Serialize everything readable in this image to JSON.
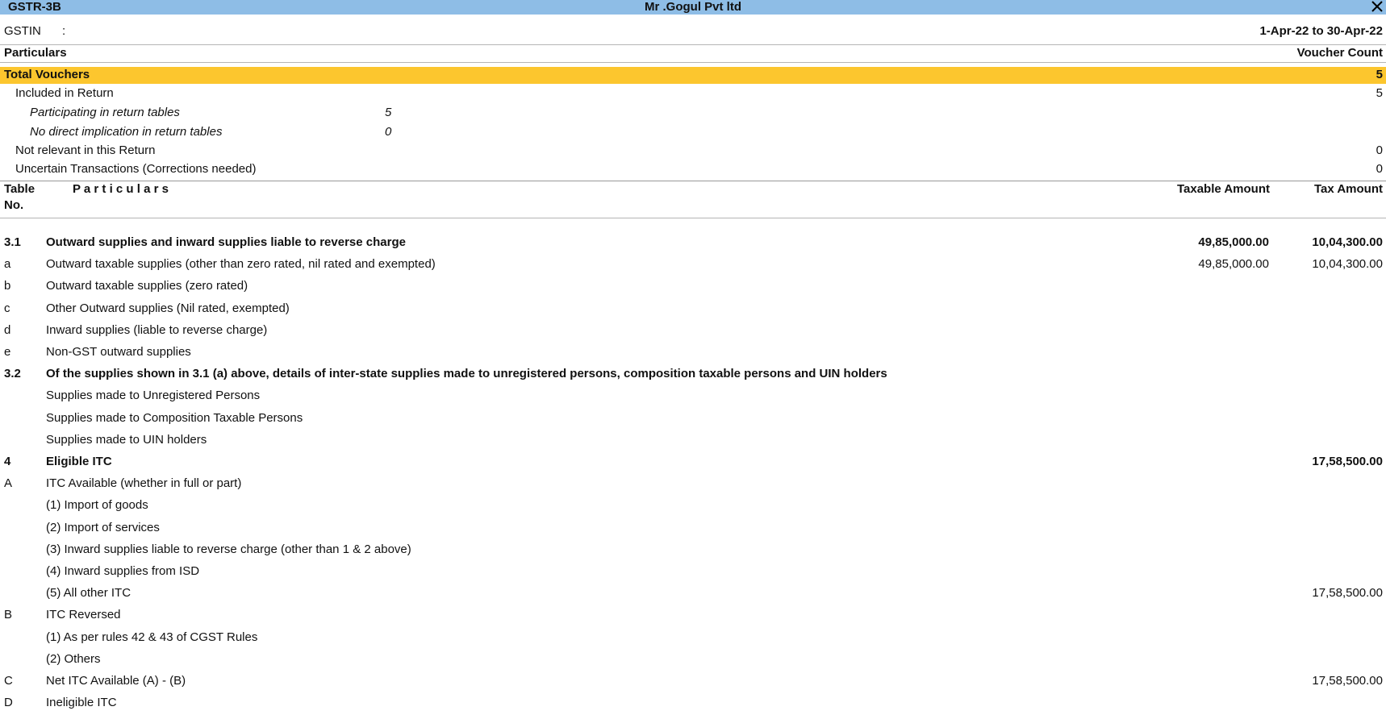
{
  "window": {
    "title": "GSTR-3B",
    "company": "Mr .Gogul Pvt ltd"
  },
  "header": {
    "gstin_label": "GSTIN",
    "gstin_colon": ":",
    "period": "1-Apr-22 to 30-Apr-22"
  },
  "summary": {
    "col_particulars": "Particulars",
    "col_count": "Voucher Count",
    "total": {
      "label": "Total Vouchers",
      "value": "5"
    },
    "included": {
      "label": "Included in Return",
      "value": "5"
    },
    "participating": {
      "label": "Participating in return tables",
      "value": "5"
    },
    "no_direct": {
      "label": "No direct implication in return tables",
      "value": "0"
    },
    "not_relevant": {
      "label": "Not relevant in this Return",
      "value": "0"
    },
    "uncertain": {
      "label": "Uncertain Transactions (Corrections needed)",
      "value": "0"
    }
  },
  "table": {
    "col_table": "Table",
    "col_no": "No.",
    "col_particulars": "P a r t i c u l a r s",
    "col_taxable": "Taxable Amount",
    "col_tax": "Tax Amount",
    "rows": [
      {
        "no": "3.1",
        "label": "Outward supplies and inward supplies liable to reverse charge",
        "taxable": "49,85,000.00",
        "tax": "10,04,300.00"
      },
      {
        "no": "a",
        "label": "Outward taxable supplies (other than zero rated, nil rated and exempted)",
        "taxable": "49,85,000.00",
        "tax": "10,04,300.00"
      },
      {
        "no": "b",
        "label": "Outward taxable supplies (zero rated)",
        "taxable": "",
        "tax": ""
      },
      {
        "no": "c",
        "label": "Other Outward supplies (Nil rated, exempted)",
        "taxable": "",
        "tax": ""
      },
      {
        "no": "d",
        "label": "Inward supplies (liable to reverse charge)",
        "taxable": "",
        "tax": ""
      },
      {
        "no": "e",
        "label": "Non-GST outward supplies",
        "taxable": "",
        "tax": ""
      },
      {
        "no": "3.2",
        "label": "Of the supplies shown in 3.1 (a) above, details of inter-state supplies made to unregistered persons, composition taxable persons and UIN holders",
        "taxable": "",
        "tax": ""
      },
      {
        "no": "",
        "label": "Supplies made to Unregistered Persons",
        "taxable": "",
        "tax": ""
      },
      {
        "no": "",
        "label": "Supplies made to Composition Taxable Persons",
        "taxable": "",
        "tax": ""
      },
      {
        "no": "",
        "label": "Supplies made to UIN holders",
        "taxable": "",
        "tax": ""
      },
      {
        "no": "4",
        "label": "Eligible ITC",
        "taxable": "",
        "tax": "17,58,500.00"
      },
      {
        "no": "A",
        "label": "ITC Available (whether in full or part)",
        "taxable": "",
        "tax": ""
      },
      {
        "no": "",
        "label": "(1) Import of goods",
        "taxable": "",
        "tax": ""
      },
      {
        "no": "",
        "label": "(2) Import of services",
        "taxable": "",
        "tax": ""
      },
      {
        "no": "",
        "label": "(3) Inward supplies liable to reverse charge (other than 1 & 2 above)",
        "taxable": "",
        "tax": ""
      },
      {
        "no": "",
        "label": "(4) Inward supplies from ISD",
        "taxable": "",
        "tax": ""
      },
      {
        "no": "",
        "label": "(5) All other ITC",
        "taxable": "",
        "tax": "17,58,500.00"
      },
      {
        "no": "B",
        "label": "ITC Reversed",
        "taxable": "",
        "tax": ""
      },
      {
        "no": "",
        "label": "(1) As per rules 42 & 43 of CGST Rules",
        "taxable": "",
        "tax": ""
      },
      {
        "no": "",
        "label": "(2) Others",
        "taxable": "",
        "tax": ""
      },
      {
        "no": "C",
        "label": "Net ITC Available (A) - (B)",
        "taxable": "",
        "tax": "17,58,500.00"
      },
      {
        "no": "D",
        "label": "Ineligible ITC",
        "taxable": "",
        "tax": ""
      }
    ]
  }
}
